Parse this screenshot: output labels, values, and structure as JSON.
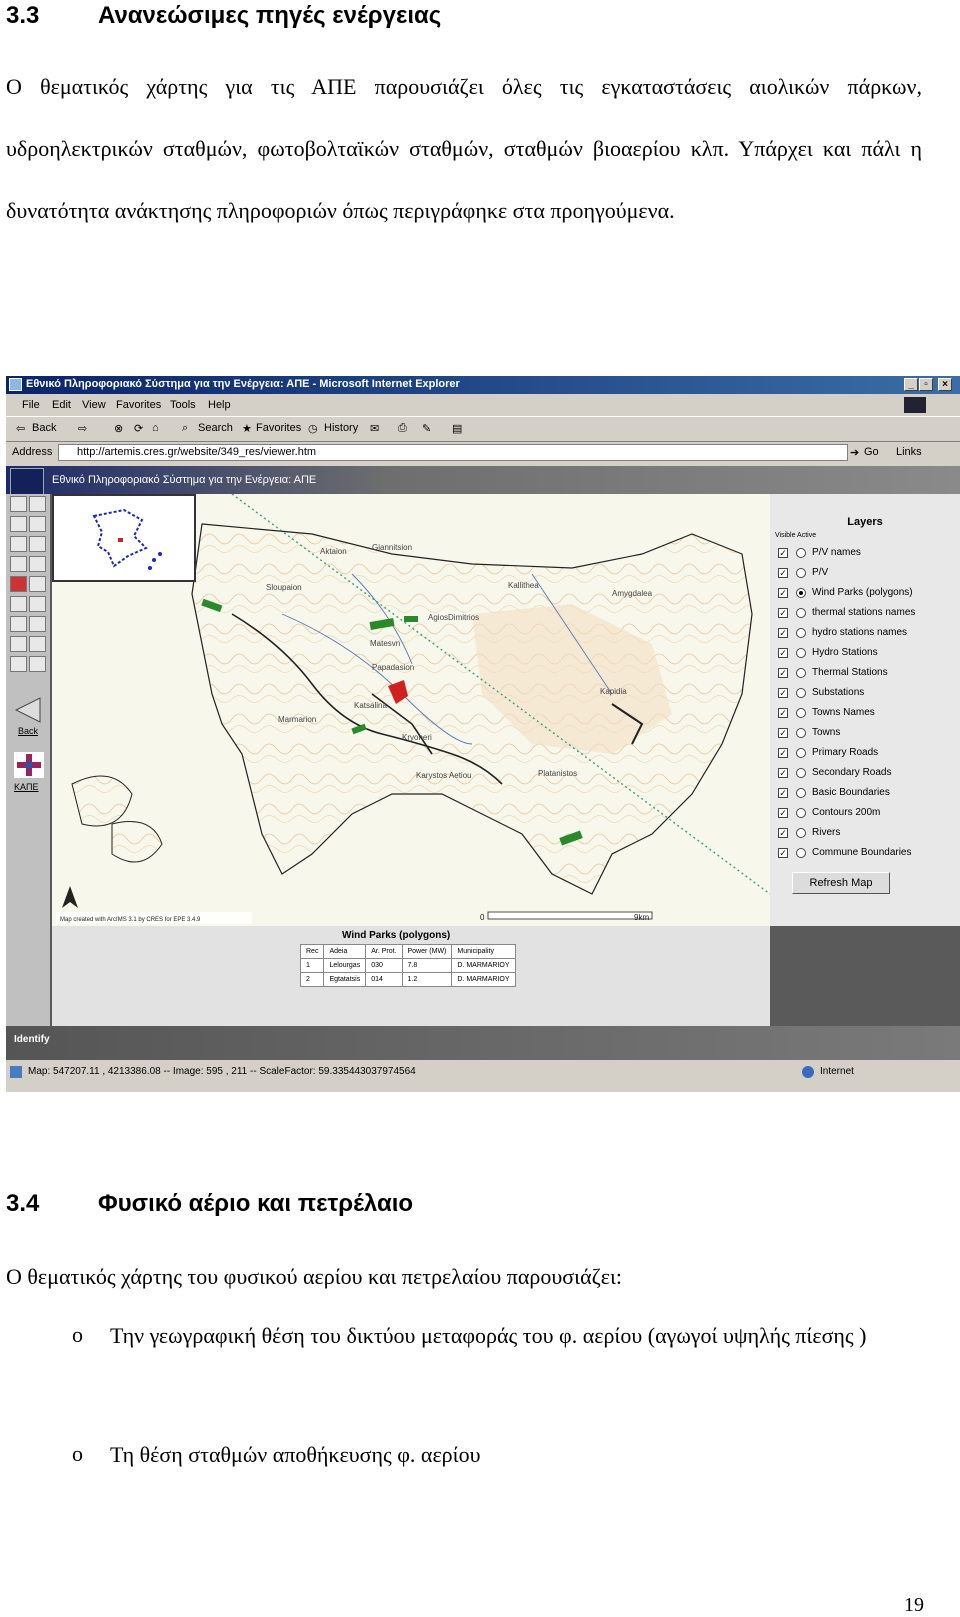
{
  "section1": {
    "number": "3.3",
    "title": "Ανανεώσιμες πηγές ενέργειας"
  },
  "para1": "Ο θεματικός χάρτης για τις ΑΠΕ παρουσιάζει όλες τις εγκαταστάσεις αιολικών πάρκων, υδροηλεκτρικών σταθμών, φωτοβολταϊκών σταθμών, σταθμών βιοαερίου κλπ. Υπάρχει και πάλι η δυνατότητα ανάκτησης πληροφοριών όπως περιγράφηκε στα προηγούμενα.",
  "browser": {
    "window_title": "Εθνικό Πληροφοριακό Σύστημα για την Ενέργεια: ΑΠΕ - Microsoft Internet Explorer",
    "menu": [
      "File",
      "Edit",
      "View",
      "Favorites",
      "Tools",
      "Help"
    ],
    "toolbar": {
      "back": "Back",
      "search": "Search",
      "favorites": "Favorites",
      "history": "History"
    },
    "address_label": "Address",
    "address": "http://artemis.cres.gr/website/349_res/viewer.htm",
    "go": "Go",
    "links": "Links",
    "status_left": "Map: 547207.11 , 4213386.08 -- Image: 595 , 211 -- ScaleFactor: 59.335443037974564",
    "status_right": "Internet"
  },
  "app": {
    "banner": "Εθνικό Πληροφοριακό Σύστημα για την Ενέργεια: ΑΠΕ",
    "back_label": "Back",
    "ape_label": "ΚΑΠΕ",
    "map_credit": "Map created with ArcIMS 3.1 by CRES for EPE 3.4.9",
    "scale_start": "0",
    "scale_end": "9km",
    "place_names": [
      "Aktaion",
      "Giannitsion",
      "Kallithea",
      "Amygdalea",
      "Sloupaion",
      "AgiosDimitrios",
      "Matesvn",
      "Papadasion",
      "Katsalina",
      "Platanistos",
      "Marmarion",
      "Kryoneri",
      "Karystos Aetiou",
      "Kapidia"
    ],
    "layers_title": "Layers",
    "layers_sub": "Visible  Active",
    "layers": [
      {
        "label": "P/V names",
        "active": false
      },
      {
        "label": "P/V",
        "active": false
      },
      {
        "label": "Wind Parks (polygons)",
        "active": true
      },
      {
        "label": "thermal stations names",
        "active": false
      },
      {
        "label": "hydro stations names",
        "active": false
      },
      {
        "label": "Hydro Stations",
        "active": false
      },
      {
        "label": "Thermal Stations",
        "active": false
      },
      {
        "label": "Substations",
        "active": false
      },
      {
        "label": "Towns Names",
        "active": false
      },
      {
        "label": "Towns",
        "active": false
      },
      {
        "label": "Primary Roads",
        "active": false
      },
      {
        "label": "Secondary Roads",
        "active": false
      },
      {
        "label": "Basic Boundaries",
        "active": false
      },
      {
        "label": "Contours 200m",
        "active": false
      },
      {
        "label": "Rivers",
        "active": false
      },
      {
        "label": "Commune Boundaries",
        "active": false
      }
    ],
    "refresh": "Refresh Map",
    "results_title": "Wind Parks (polygons)",
    "results_headers": [
      "Rec",
      "Adeia",
      "Ar. Prot.",
      "Power (MW)",
      "Municipality"
    ],
    "results_rows": [
      [
        "1",
        "Lelourgas",
        "030",
        "7.8",
        "D. MARMARIOY"
      ],
      [
        "2",
        "Egtatatsis",
        "014",
        "1.2",
        "D. MARMARIOY"
      ]
    ],
    "identify": "Identify"
  },
  "section2": {
    "number": "3.4",
    "title": "Φυσικό αέριο και πετρέλαιο"
  },
  "para2": "Ο θεματικός χάρτης του φυσικού αερίου και πετρελαίου παρουσιάζει:",
  "bullet_marker": "o",
  "bullets": [
    "Την γεωγραφική θέση του δικτύου μεταφοράς του φ. αερίου (αγωγοί υψηλής πίεσης )",
    "Τη θέση σταθμών αποθήκευσης φ. αερίου"
  ],
  "page_number": "19"
}
